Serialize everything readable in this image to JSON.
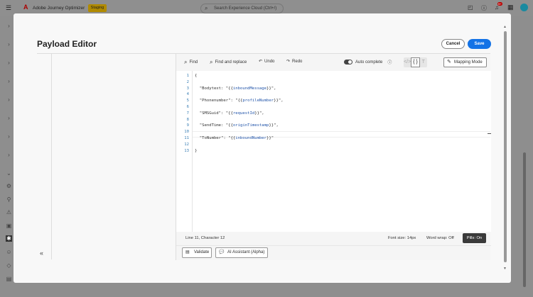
{
  "topbar": {
    "app_name": "Adobe Journey Optimizer",
    "env_badge": "Staging",
    "search_placeholder": "Search Experience Cloud (Ctrl+/)",
    "notification_count": "9+"
  },
  "modal": {
    "title": "Payload Editor",
    "cancel_label": "Cancel",
    "save_label": "Save"
  },
  "toolbar": {
    "find": "Find",
    "find_replace": "Find and replace",
    "undo": "Undo",
    "redo": "Redo",
    "autocomplete": "Auto complete",
    "mapping_mode": "Mapping Mode",
    "autocomplete_on": true
  },
  "code": {
    "lines": [
      {
        "n": "1",
        "pre": "{",
        "var": "",
        "post": ""
      },
      {
        "n": "2",
        "pre": "",
        "var": "",
        "post": ""
      },
      {
        "n": "3",
        "pre": "  \"Bodytext: \"{{",
        "var": "inboundMessage",
        "post": "}}\","
      },
      {
        "n": "4",
        "pre": "",
        "var": "",
        "post": ""
      },
      {
        "n": "5",
        "pre": "  \"Phonenumber\": \"{{",
        "var": "profileNumber",
        "post": "}}\","
      },
      {
        "n": "6",
        "pre": "",
        "var": "",
        "post": ""
      },
      {
        "n": "7",
        "pre": "  \"SMSGuid\": \"{{",
        "var": "requestId",
        "post": "}}\","
      },
      {
        "n": "8",
        "pre": "",
        "var": "",
        "post": ""
      },
      {
        "n": "9",
        "pre": "  \"SendTime: \"{{",
        "var": "originTimestamp",
        "post": "}}\","
      },
      {
        "n": "10",
        "pre": "",
        "var": "",
        "post": ""
      },
      {
        "n": "11",
        "pre": "  \"ToNumber\": \"{{",
        "var": "inboundNumber",
        "post": "}}\""
      },
      {
        "n": "12",
        "pre": "",
        "var": "",
        "post": ""
      },
      {
        "n": "13",
        "pre": "}",
        "var": "",
        "post": ""
      }
    ]
  },
  "status": {
    "position": "Line 11, Character 12",
    "font_size": "Font size: 14px",
    "word_wrap": "Word wrap: Off",
    "pills": "Pills: On"
  },
  "footer": {
    "validate": "Validate",
    "ai_assistant": "AI Assistant (Alpha)"
  }
}
